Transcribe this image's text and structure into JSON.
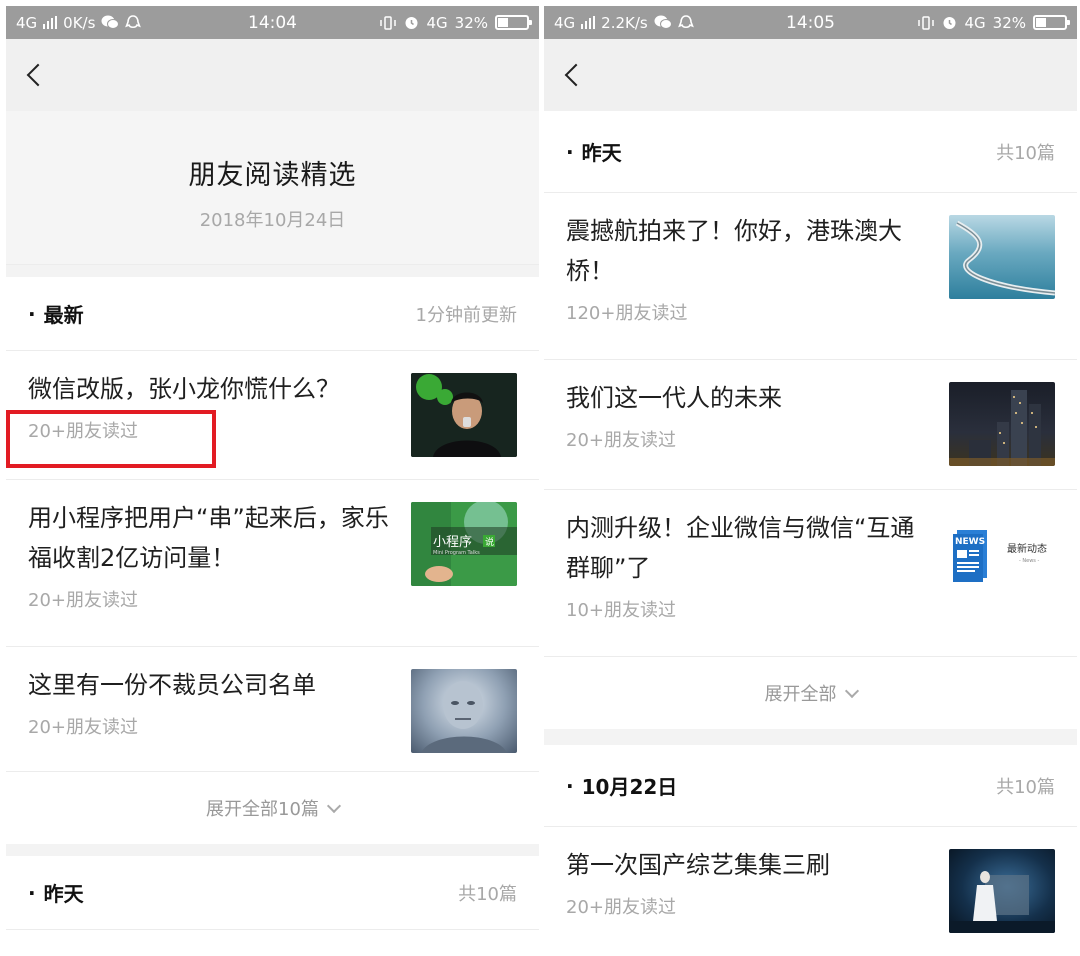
{
  "left": {
    "status": {
      "network": "4G",
      "speed": "0K/s",
      "time": "14:04",
      "net2": "4G",
      "battery": "32%"
    },
    "hero": {
      "title": "朋友阅读精选",
      "date": "2018年10月24日"
    },
    "sections": [
      {
        "title": "最新",
        "meta": "1分钟前更新",
        "articles": [
          {
            "title": "微信改版，张小龙你慌什么？",
            "reads": "20+朋友读过"
          },
          {
            "title": "用小程序把用户“串”起来后，家乐福收割2亿访问量！",
            "reads": "20+朋友读过"
          },
          {
            "title": "这里有一份不裁员公司名单",
            "reads": "20+朋友读过"
          }
        ],
        "expand": "展开全部10篇"
      },
      {
        "title": "昨天",
        "meta": "共10篇"
      }
    ]
  },
  "right": {
    "status": {
      "network": "4G",
      "speed": "2.2K/s",
      "time": "14:05",
      "net2": "4G",
      "battery": "32%"
    },
    "sections": [
      {
        "title": "昨天",
        "meta": "共10篇",
        "articles": [
          {
            "title": "震撼航拍来了！你好，港珠澳大桥！",
            "reads": "120+朋友读过"
          },
          {
            "title": "我们这一代人的未来",
            "reads": "20+朋友读过"
          },
          {
            "title": "内测升级！企业微信与微信“互通群聊”了",
            "reads": "10+朋友读过"
          }
        ],
        "expand": "展开全部"
      },
      {
        "title": "10月22日",
        "meta": "共10篇",
        "articles": [
          {
            "title": "第一次国产综艺集集三刷",
            "reads": "20+朋友读过"
          }
        ]
      }
    ]
  },
  "thumb_text": {
    "miniprog": "小程序",
    "miniprog_badge": "说",
    "miniprog_sub": "Mini Program Talks",
    "news_badge": "NEWS",
    "news_title": "最新动态",
    "news_sub": "- News -"
  },
  "colors": {
    "highlight": "#e21b23",
    "statusbar": "#9c9c9c",
    "muted": "#a8a8a8"
  }
}
